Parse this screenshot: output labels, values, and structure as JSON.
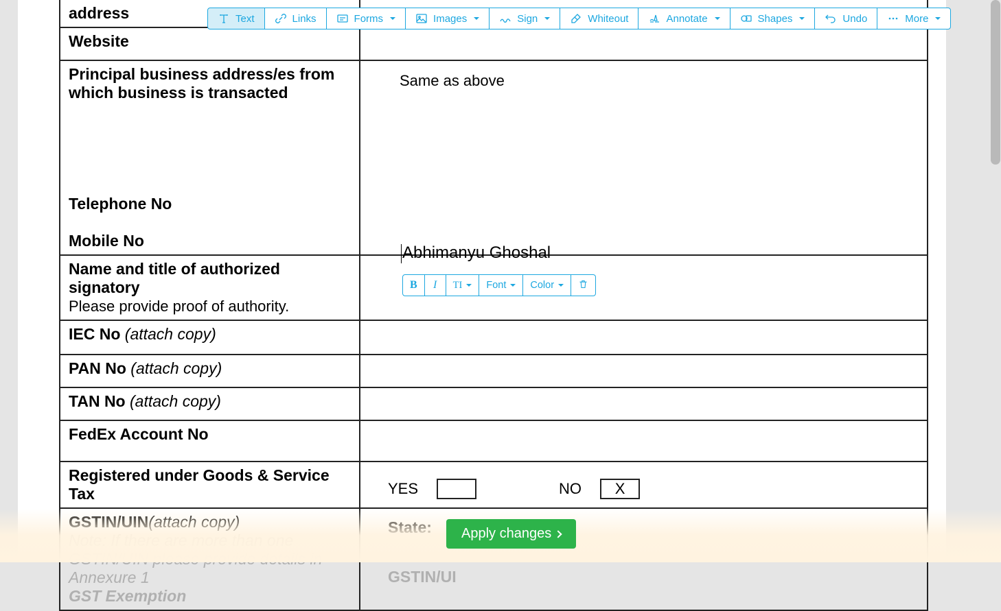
{
  "toolbar": {
    "text": "Text",
    "links": "Links",
    "forms": "Forms",
    "images": "Images",
    "sign": "Sign",
    "whiteout": "Whiteout",
    "annotate": "Annotate",
    "shapes": "Shapes",
    "undo": "Undo",
    "more": "More"
  },
  "rows": {
    "address": "address",
    "website": "Website",
    "principal": "Principal business address/es from which business is transacted",
    "telephone": "Telephone No",
    "mobile": "Mobile No",
    "signatory": "Name and title of authorized signatory",
    "signatory_note": "Please provide proof of authority.",
    "iec": "IEC No ",
    "iec_note": "(attach copy)",
    "pan": "PAN No ",
    "pan_note": "(attach copy)",
    "tan": "TAN No ",
    "tan_note": "(attach copy)",
    "fedex": "FedEx Account No",
    "gst": "Registered under Goods & Service Tax",
    "gstin": "GSTIN/UIN",
    "gstin_note": "(attach copy)",
    "gstin_note2": "Note: If there are more than one GSTIN/UIN please provide details in Annexure 1",
    "gst_exempt": "GST Exemption"
  },
  "values": {
    "principal": "Same as above",
    "signatory_input": "Abhimanyu Ghoshal",
    "yes_label": "YES",
    "no_label": "NO",
    "no_mark": "X",
    "state_label": "State:",
    "gstin_label": "GSTIN/UI"
  },
  "mini_toolbar": {
    "bold": "B",
    "italic": "I",
    "size": "TI",
    "font": "Font",
    "color": "Color"
  },
  "apply_button": "Apply changes"
}
